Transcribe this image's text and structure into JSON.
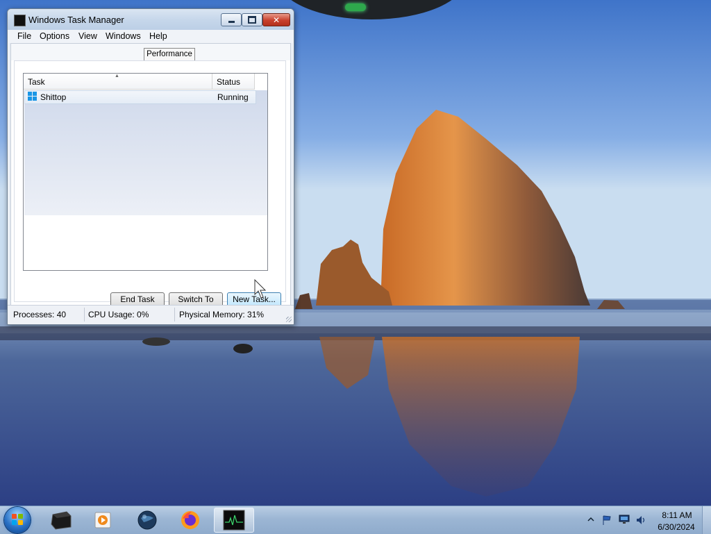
{
  "window": {
    "title": "Windows Task Manager",
    "menu": [
      "File",
      "Options",
      "View",
      "Windows",
      "Help"
    ],
    "tab": "Performance",
    "columns": {
      "task": "Task",
      "status": "Status"
    },
    "rows": [
      {
        "task": "Shittop",
        "status": "Running"
      }
    ],
    "buttons": {
      "end_task": "End Task",
      "switch_to": "Switch To",
      "new_task": "New Task..."
    },
    "status": {
      "processes": "Processes: 40",
      "cpu": "CPU Usage: 0%",
      "memory": "Physical Memory: 31%"
    }
  },
  "taskbar": {
    "apps": [
      "terminal-app",
      "media-player",
      "globe-app",
      "firefox",
      "task-manager"
    ],
    "clock": {
      "time": "8:11 AM",
      "date": "6/30/2024"
    }
  },
  "colors": {
    "accent": "#2a72c6",
    "close_button": "#c8402c",
    "taskbar": "#9cb6d4"
  }
}
